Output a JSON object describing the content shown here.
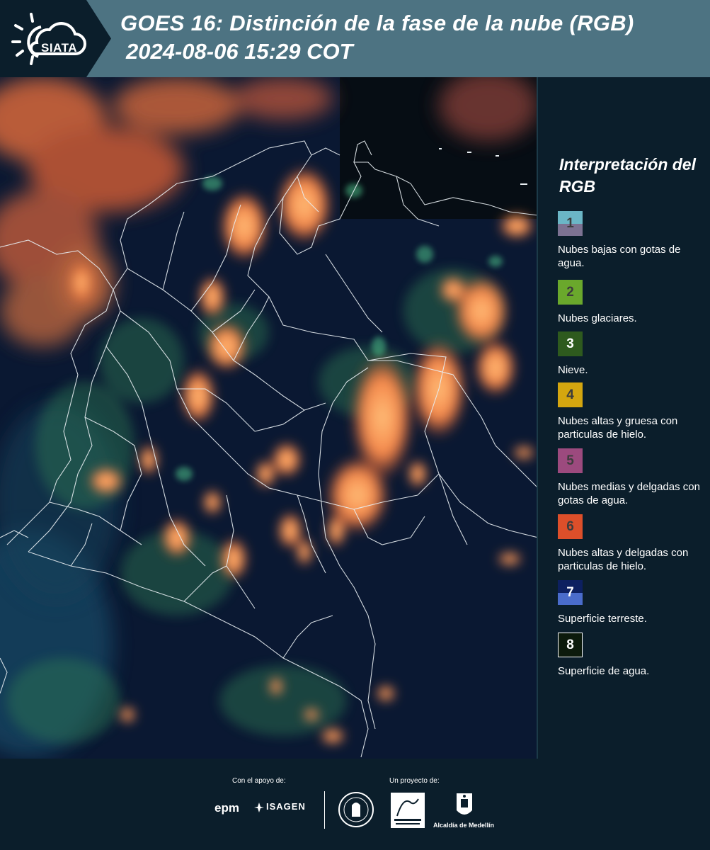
{
  "header": {
    "logo_text": "SIATA",
    "title": "GOES 16: Distinción de la fase de la nube (RGB)",
    "subtitle": "2024-08-06 15:29 COT"
  },
  "legend": {
    "title": "Interpretación del RGB",
    "items": [
      {
        "number": "1",
        "label": "Nubes bajas con gotas de agua.",
        "colors": [
          "#6bb6c6",
          "#7c7292"
        ]
      },
      {
        "number": "2",
        "label": "Nubes glaciares.",
        "colors": [
          "#6aa82c"
        ]
      },
      {
        "number": "3",
        "label": "Nieve.",
        "colors": [
          "#2e5a1e"
        ]
      },
      {
        "number": "4",
        "label": "Nubes altas y gruesa con particulas de hielo.",
        "colors": [
          "#d4a60f"
        ]
      },
      {
        "number": "5",
        "label": "Nubes medias y delgadas con gotas de agua.",
        "colors": [
          "#9c4a7e"
        ]
      },
      {
        "number": "6",
        "label": "Nubes altas y delgadas con particulas de hielo.",
        "colors": [
          "#dd4f2a"
        ]
      },
      {
        "number": "7",
        "label": "Superficie terreste.",
        "colors": [
          "#0d2060",
          "#4a6ccb"
        ]
      },
      {
        "number": "8",
        "label": "Superficie de agua.",
        "colors": [
          "#0c1a0c"
        ]
      }
    ]
  },
  "footer": {
    "support_label": "Con el apoyo de:",
    "project_label": "Un proyecto de:",
    "epm": "epm",
    "isagen": "ISAGEN",
    "alcaldia": "Alcaldía de Medellín"
  }
}
